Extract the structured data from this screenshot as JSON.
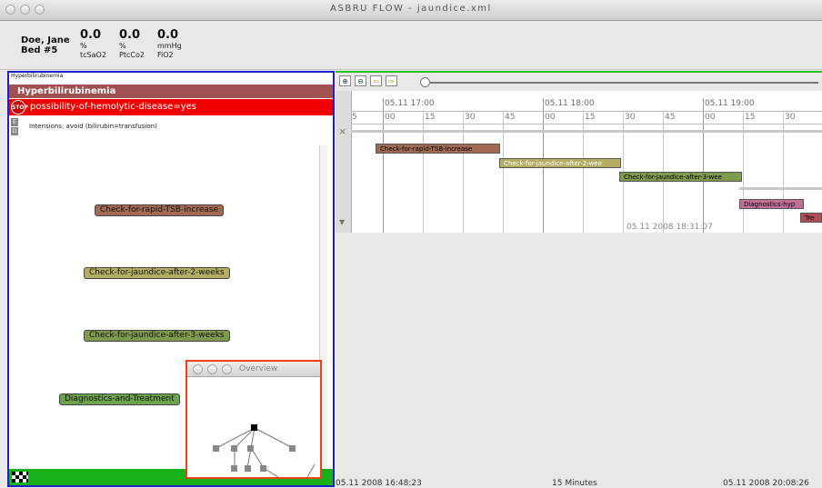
{
  "window": {
    "title": "ASBRU FLOW - jaundice.xml"
  },
  "patient": {
    "name": "Doe, Jane",
    "bed": "Bed #5",
    "vitals": [
      {
        "value": "0.0",
        "unit": "%",
        "label": "tcSaO2"
      },
      {
        "value": "0.0",
        "unit": "%",
        "label": "PtcCo2"
      },
      {
        "value": "0.0",
        "unit": "mmHg",
        "label": "FiO2"
      }
    ]
  },
  "left_panel": {
    "breadcrumb": "Hyperbilirubinemia",
    "header": "Hyperbilirubinemia",
    "condition": "possibility-of-hemolytic-disease=yes",
    "stop_label": "STOP",
    "intentions": "Intensions: avoid (bilirubin=transfusion)",
    "mini_icons": [
      "E",
      "D"
    ],
    "plans": [
      {
        "label": "Check-for-rapid-TSB-increase",
        "color": "#a26a52"
      },
      {
        "label": "Check-for-jaundice-after-2-weeks",
        "color": "#b4ad62"
      },
      {
        "label": "Check-for-jaundice-after-3-weeks",
        "color": "#7e9a4e"
      },
      {
        "label": "Diagnostics-and-Treatment",
        "color": "#6ea34e"
      }
    ]
  },
  "overview": {
    "title": "Overview"
  },
  "toolbar": {
    "zoom_in": "⊕",
    "zoom_out": "⊖",
    "back": "⇦",
    "forward": "⇨"
  },
  "timeline": {
    "hours": [
      "05.11 17:00",
      "05.11 18:00",
      "05.11 19:00"
    ],
    "minutes": [
      "5",
      "00",
      "15",
      "30",
      "45",
      "00",
      "15",
      "30",
      "45",
      "00",
      "15",
      "30"
    ],
    "current_time": "05.11 2008 18:31:07",
    "close": "×",
    "scroll_down": "▼",
    "bars": [
      {
        "label": "Check-for-rapid-TSB-increase",
        "color": "#a26a52"
      },
      {
        "label": "Check-for-jaundice-after-2-wee",
        "color": "#b4ad62"
      },
      {
        "label": "Check-for-jaundice-after-3-wee",
        "color": "#7e9a4e"
      },
      {
        "label": "Diagnostics-hyp",
        "color": "#c07098"
      },
      {
        "label": "Tre",
        "color": "#b04c58"
      }
    ]
  },
  "status": {
    "start": "05.11 2008 16:48:23",
    "interval": "15 Minutes",
    "end": "05.11 2008 20:08:26"
  }
}
